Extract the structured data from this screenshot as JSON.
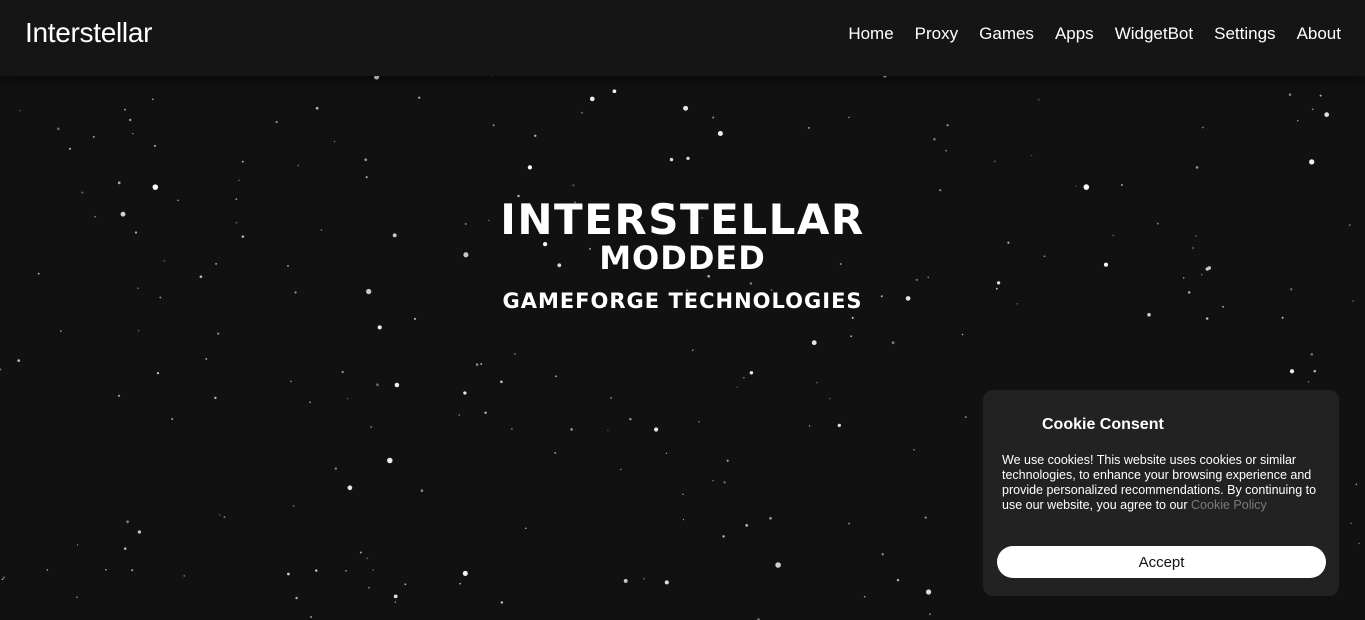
{
  "nav": {
    "brand": "Interstellar",
    "links": [
      "Home",
      "Proxy",
      "Games",
      "Apps",
      "WidgetBot",
      "Settings",
      "About"
    ]
  },
  "hero": {
    "title": "INTERSTELLAR",
    "subtitle": "MODDED",
    "company": "GAMEFORGE TECHNOLOGIES"
  },
  "cookie": {
    "title": "Cookie Consent",
    "body": "We use cookies! This website uses cookies or similar technologies, to enhance your browsing experience and provide personalized recommendations. By continuing to use our website, you agree to our",
    "link": "Cookie Policy",
    "accept_label": "Accept"
  },
  "colors": {
    "background": "#111111",
    "navbar": "#151515",
    "cookie_panel": "#222222",
    "link_muted": "#7a7a7a",
    "text": "#ffffff"
  }
}
